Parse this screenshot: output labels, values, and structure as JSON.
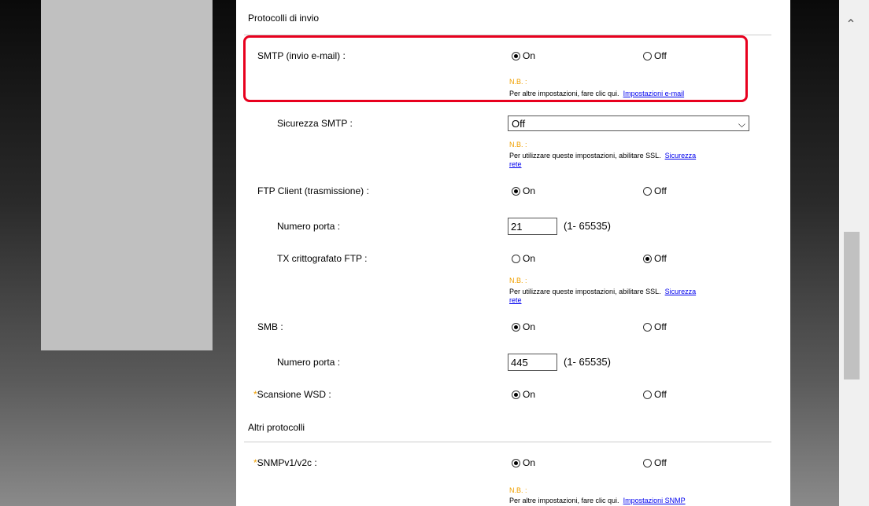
{
  "sections": {
    "invio": "Protocolli di invio",
    "altri": "Altri protocolli"
  },
  "rows": {
    "smtp": {
      "label": "SMTP (invio e-mail) :",
      "on": "On",
      "off": "Off",
      "nb_title": "N.B. :",
      "nb_text": "Per altre impostazioni, fare clic qui.",
      "nb_link": "Impostazioni e-mail"
    },
    "smtp_security": {
      "label": "Sicurezza SMTP :",
      "value": "Off",
      "nb_title": "N.B. :",
      "nb_text": "Per utilizzare queste impostazioni, abilitare SSL.",
      "nb_link_1": "Sicurezza",
      "nb_link_2": "rete"
    },
    "ftp": {
      "label": "FTP Client (trasmissione) :",
      "on": "On",
      "off": "Off"
    },
    "ftp_port": {
      "label": "Numero porta :",
      "value": "21",
      "range": "(1- 65535)"
    },
    "ftp_tx": {
      "label": "TX crittografato FTP :",
      "on": "On",
      "off": "Off",
      "nb_title": "N.B. :",
      "nb_text": "Per utilizzare queste impostazioni, abilitare SSL.",
      "nb_link_1": "Sicurezza",
      "nb_link_2": "rete"
    },
    "smb": {
      "label": "SMB :",
      "on": "On",
      "off": "Off"
    },
    "smb_port": {
      "label": "Numero porta :",
      "value": "445",
      "range": "(1- 65535)"
    },
    "wsd": {
      "star": "*",
      "label": "Scansione WSD :",
      "on": "On",
      "off": "Off"
    },
    "snmp": {
      "star": "*",
      "label": "SNMPv1/v2c :",
      "on": "On",
      "off": "Off",
      "nb_title": "N.B. :",
      "nb_text": "Per altre impostazioni, fare clic qui.",
      "nb_link": "Impostazioni SNMP"
    }
  },
  "colors": {
    "highlight": "#e8001e",
    "nb": "#f0a000",
    "link": "#0000ee"
  }
}
